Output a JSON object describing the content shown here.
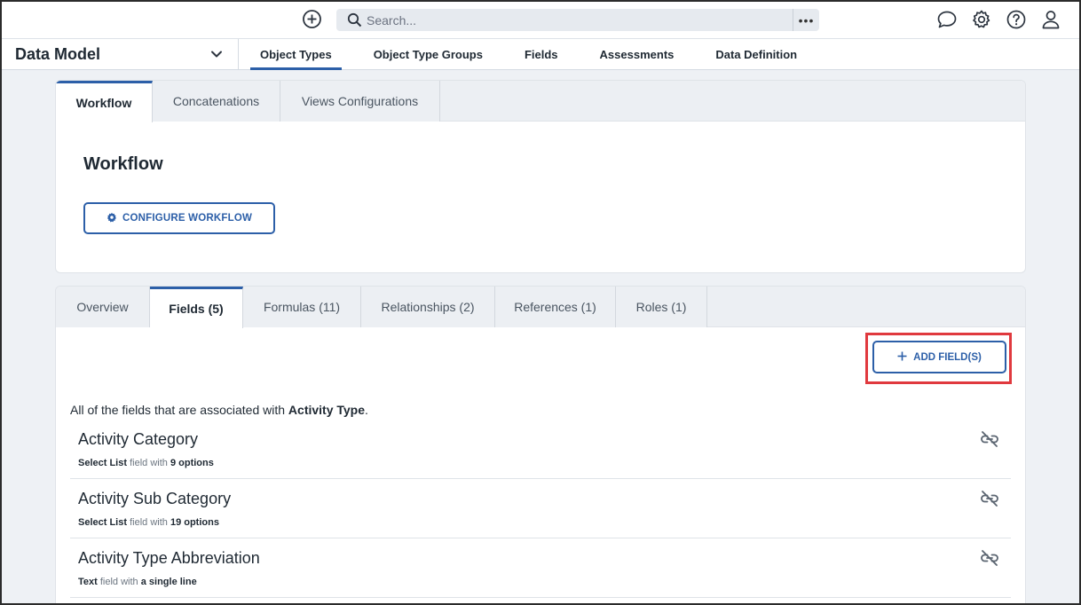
{
  "topbar": {
    "search_placeholder": "Search...",
    "more_label": "•••",
    "icons": [
      "add-circle-icon",
      "search-icon",
      "chat-icon",
      "gear-icon",
      "help-icon",
      "user-icon"
    ]
  },
  "subnav": {
    "module_title": "Data Model",
    "tabs": [
      {
        "label": "Object Types",
        "active": true
      },
      {
        "label": "Object Type Groups",
        "active": false
      },
      {
        "label": "Fields",
        "active": false
      },
      {
        "label": "Assessments",
        "active": false
      },
      {
        "label": "Data Definition",
        "active": false
      }
    ]
  },
  "workflow_card": {
    "tabs": [
      {
        "label": "Workflow",
        "active": true
      },
      {
        "label": "Concatenations",
        "active": false
      },
      {
        "label": "Views Configurations",
        "active": false
      }
    ],
    "title": "Workflow",
    "configure_button": "CONFIGURE WORKFLOW"
  },
  "fields_card": {
    "tabs": [
      {
        "label": "Overview",
        "active": false
      },
      {
        "label": "Fields (5)",
        "active": true
      },
      {
        "label": "Formulas (11)",
        "active": false
      },
      {
        "label": "Relationships (2)",
        "active": false
      },
      {
        "label": "References (1)",
        "active": false
      },
      {
        "label": "Roles (1)",
        "active": false
      }
    ],
    "add_button": "ADD FIELD(S)",
    "intro_prefix": "All of the fields that are associated with ",
    "intro_object": "Activity Type",
    "intro_suffix": ".",
    "fields": [
      {
        "name": "Activity Category",
        "type": "Select List",
        "connector": " field with ",
        "detail": "9 options"
      },
      {
        "name": "Activity Sub Category",
        "type": "Select List",
        "connector": " field with ",
        "detail": "19 options"
      },
      {
        "name": "Activity Type Abbreviation",
        "type": "Text",
        "connector": " field with ",
        "detail": "a single line"
      }
    ]
  },
  "colors": {
    "accent": "#2c5fa8",
    "highlight": "#e0393e",
    "background": "#eef1f5"
  }
}
